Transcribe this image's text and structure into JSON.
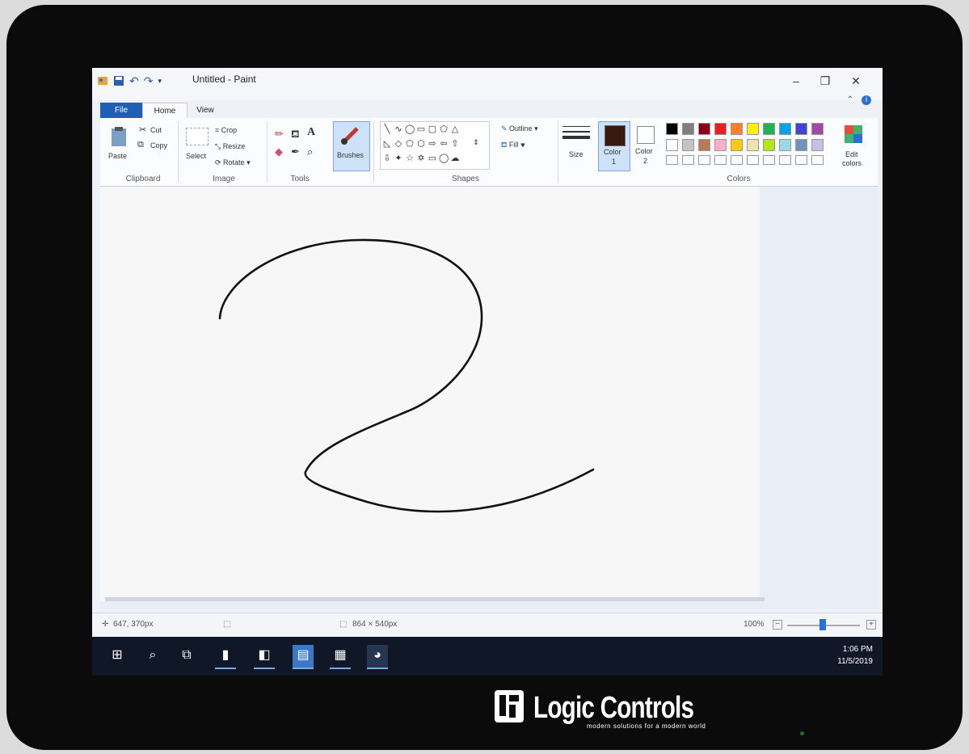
{
  "window": {
    "title": "Untitled - Paint"
  },
  "tabs": [
    {
      "label": "File",
      "active": false
    },
    {
      "label": "Home",
      "active": true
    },
    {
      "label": "View",
      "active": false
    }
  ],
  "ribbon": {
    "clipboard": {
      "group": "Clipboard",
      "paste": "Paste",
      "cut": "Cut",
      "copy": "Copy"
    },
    "image": {
      "group": "Image",
      "select": "Select",
      "crop": "Crop",
      "resize": "Resize",
      "rotate": "Rotate"
    },
    "tools": {
      "group": "Tools"
    },
    "brushes": {
      "label": "Brushes"
    },
    "shapes": {
      "group": "Shapes",
      "outline": "Outline",
      "fill": "Fill"
    },
    "size": {
      "label": "Size"
    },
    "color1": {
      "label": "Color",
      "number": "1",
      "value": "#3a1a10"
    },
    "color2": {
      "label": "Color",
      "number": "2",
      "value": "#ffffff"
    },
    "colors": {
      "group": "Colors"
    },
    "edit_colors": {
      "line1": "Edit",
      "line2": "colors"
    }
  },
  "palette": {
    "row1": [
      "#000000",
      "#7f7f7f",
      "#880015",
      "#ed1c24",
      "#ff7f27",
      "#fff200",
      "#22b14c",
      "#00a2e8",
      "#3f48cc",
      "#a349a4"
    ],
    "row2": [
      "#ffffff",
      "#c3c3c3",
      "#b97a57",
      "#ffaec9",
      "#ffc90e",
      "#efe4b0",
      "#b5e61d",
      "#99d9ea",
      "#7092be",
      "#c8bfe7"
    ]
  },
  "status": {
    "cursor_pos": "647, 370px",
    "image_size": "864 × 540px",
    "zoom": "100%"
  },
  "taskbar": {
    "time": "1:06 PM",
    "date": "11/5/2019"
  },
  "device": {
    "brand": "Logic Controls",
    "tagline": "modern solutions for a modern world"
  }
}
